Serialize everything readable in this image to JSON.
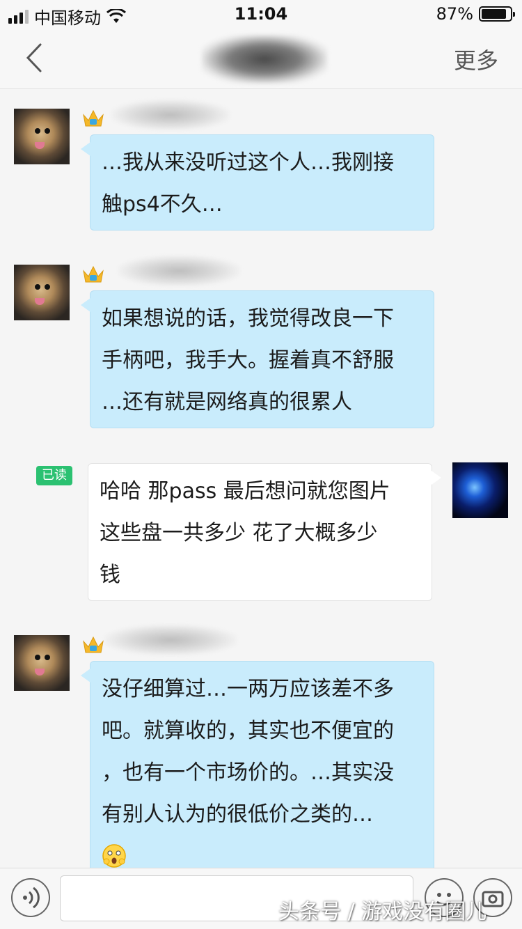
{
  "status_bar": {
    "carrier": "中国移动",
    "time": "11:04",
    "battery_percent": "87%",
    "battery_level": 0.87
  },
  "nav": {
    "more_label": "更多"
  },
  "messages": [
    {
      "side": "left",
      "text": "…我从来没听过这个人…我刚接\n触ps4不久…"
    },
    {
      "side": "left",
      "text": "如果想说的话，我觉得改良一下\n手柄吧，我手大。握着真不舒服\n…还有就是网络真的很累人"
    },
    {
      "side": "right",
      "text": "哈哈 那pass 最后想问就您图片\n这些盘一共多少 花了大概多少\n钱",
      "read_label": "已读"
    },
    {
      "side": "left",
      "text": "没仔细算过…一两万应该差不多\n吧。就算收的，其实也不便宜的\n，也有一个市场价的。…其实没\n有别人认为的很低价之类的…"
    }
  ],
  "input": {
    "value": "",
    "placeholder": ""
  },
  "watermark": "头条号 / 游戏没有圈儿",
  "colors": {
    "bubble_left": "#c9ecfc",
    "bubble_right": "#ffffff",
    "read_badge": "#2bc171"
  }
}
